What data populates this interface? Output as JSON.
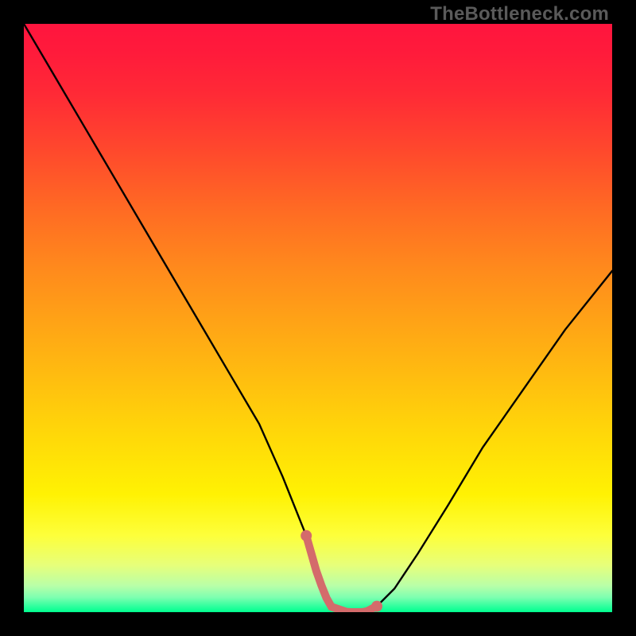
{
  "watermark": "TheBottleneck.com",
  "colors": {
    "page_bg": "#000000",
    "curve": "#000000",
    "bottom_marker": "#d46b6b",
    "gradient_top": "#ff153e",
    "gradient_bottom": "#00ff8e"
  },
  "chart_data": {
    "type": "line",
    "title": "",
    "xlabel": "",
    "ylabel": "",
    "xlim": [
      0,
      100
    ],
    "ylim": [
      0,
      100
    ],
    "axes_visible": false,
    "grid": false,
    "series": [
      {
        "name": "bottleneck-curve",
        "x": [
          0,
          5,
          10,
          15,
          20,
          25,
          30,
          35,
          40,
          44,
          48,
          50,
          52,
          55,
          58,
          60,
          63,
          67,
          72,
          78,
          85,
          92,
          100
        ],
        "y": [
          100,
          91.5,
          83,
          74.5,
          66,
          57.5,
          49,
          40.5,
          32,
          23,
          13,
          6,
          1,
          0,
          0,
          1,
          4,
          10,
          18,
          28,
          38,
          48,
          58
        ]
      }
    ],
    "flat_bottom_range_x": [
      48,
      60
    ],
    "annotations": [
      {
        "text": "TheBottleneck.com",
        "role": "watermark",
        "position": "top-right"
      }
    ],
    "background_gradient": {
      "direction": "vertical",
      "stops": [
        {
          "pos": 0.0,
          "color": "#ff153e"
        },
        {
          "pos": 0.22,
          "color": "#ff4a2c"
        },
        {
          "pos": 0.55,
          "color": "#ffaf13"
        },
        {
          "pos": 0.8,
          "color": "#fff203"
        },
        {
          "pos": 0.95,
          "color": "#b9ffa8"
        },
        {
          "pos": 1.0,
          "color": "#00ff8e"
        }
      ]
    }
  }
}
